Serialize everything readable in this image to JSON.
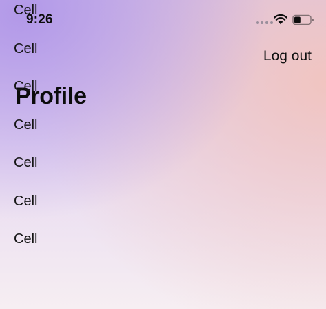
{
  "status_bar": {
    "time": "9:26"
  },
  "header": {
    "logout_label": "Log out",
    "title": "Profile"
  },
  "cells": [
    {
      "label": "Cell"
    },
    {
      "label": "Cell"
    },
    {
      "label": "Cell"
    },
    {
      "label": "Cell"
    },
    {
      "label": "Cell"
    },
    {
      "label": "Cell"
    },
    {
      "label": "Cell"
    }
  ],
  "icons": {
    "signal": "signal-dots-icon",
    "wifi": "wifi-icon",
    "battery": "battery-icon"
  },
  "colors": {
    "gradient_top_left": "#b096e8",
    "gradient_right": "#f2c4be",
    "gradient_bottom": "#f6eef2",
    "text": "#111111"
  },
  "battery": {
    "level": 0.4
  }
}
